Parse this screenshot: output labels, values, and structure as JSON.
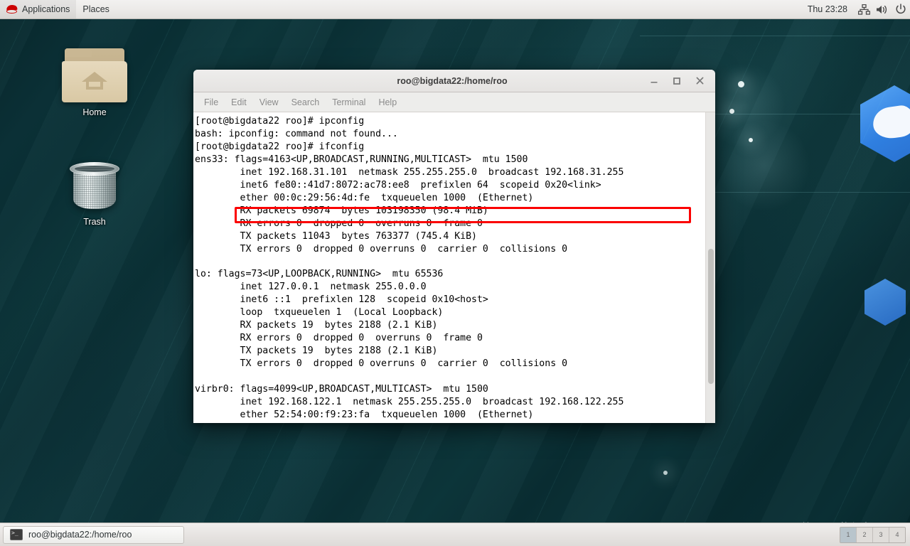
{
  "top_panel": {
    "logo_icon": "redhat-logo-icon",
    "applications_label": "Applications",
    "places_label": "Places",
    "clock": "Thu 23:28",
    "tray": [
      {
        "icon": "network-icon"
      },
      {
        "icon": "volume-icon"
      },
      {
        "icon": "power-icon"
      }
    ]
  },
  "desktop": {
    "icons": [
      {
        "name": "home",
        "label": "Home",
        "icon": "home-folder-icon"
      },
      {
        "name": "trash",
        "label": "Trash",
        "icon": "trash-can-icon"
      }
    ]
  },
  "terminal": {
    "title": "roo@bigdata22:/home/roo",
    "window_buttons": {
      "minimize": "minimize-icon",
      "maximize": "maximize-icon",
      "close": "close-icon"
    },
    "menu": [
      "File",
      "Edit",
      "View",
      "Search",
      "Terminal",
      "Help"
    ],
    "highlight_color": "#fb0000",
    "content": "[root@bigdata22 roo]# ipconfig\nbash: ipconfig: command not found...\n[root@bigdata22 roo]# ifconfig\nens33: flags=4163<UP,BROADCAST,RUNNING,MULTICAST>  mtu 1500\n        inet 192.168.31.101  netmask 255.255.255.0  broadcast 192.168.31.255\n        inet6 fe80::41d7:8072:ac78:ee8  prefixlen 64  scopeid 0x20<link>\n        ether 00:0c:29:56:4d:fe  txqueuelen 1000  (Ethernet)\n        RX packets 69874  bytes 103198350 (98.4 MiB)\n        RX errors 0  dropped 0  overruns 0  frame 0\n        TX packets 11043  bytes 763377 (745.4 KiB)\n        TX errors 0  dropped 0 overruns 0  carrier 0  collisions 0\n\nlo: flags=73<UP,LOOPBACK,RUNNING>  mtu 65536\n        inet 127.0.0.1  netmask 255.0.0.0\n        inet6 ::1  prefixlen 128  scopeid 0x10<host>\n        loop  txqueuelen 1  (Local Loopback)\n        RX packets 19  bytes 2188 (2.1 KiB)\n        RX errors 0  dropped 0  overruns 0  frame 0\n        TX packets 19  bytes 2188 (2.1 KiB)\n        TX errors 0  dropped 0 overruns 0  carrier 0  collisions 0\n\nvirbr0: flags=4099<UP,BROADCAST,MULTICAST>  mtu 1500\n        inet 192.168.122.1  netmask 255.255.255.0  broadcast 192.168.122.255\n        ether 52:54:00:f9:23:fa  txqueuelen 1000  (Ethernet)"
  },
  "bottom_panel": {
    "task_label": "roo@bigdata22:/home/roo",
    "task_icon": "terminal-icon",
    "workspaces": [
      "1",
      "2",
      "3",
      "4"
    ],
    "active_workspace": "1"
  },
  "watermark": "CSDN @总写bug的程序员"
}
